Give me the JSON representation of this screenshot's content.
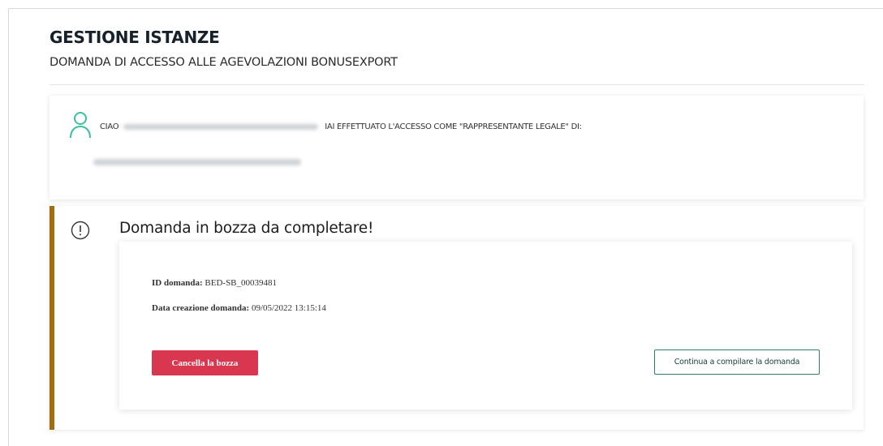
{
  "header": {
    "title": "GESTIONE ISTANZE",
    "subtitle": "DOMANDA DI ACCESSO ALLE AGEVOLAZIONI BONUSEXPORT"
  },
  "user_card": {
    "greeting_prefix": "CIAO",
    "greeting_suffix": "IAI EFFETTUATO L'ACCESSO COME \"RAPPRESENTANTE LEGALE\" DI:",
    "icon": "user-icon"
  },
  "notice": {
    "icon": "warning-circle-icon",
    "title": "Domanda in bozza da completare!",
    "id_label": "ID domanda:",
    "id_value": "BED-SB_00039481",
    "date_label": "Data creazione domanda:",
    "date_value": "09/05/2022 13:15:14",
    "delete_button": "Cancella la bozza",
    "continue_button": "Continua a compilare la domanda"
  },
  "colors": {
    "accent_green": "#2e7d6f",
    "user_icon": "#3cbf9e",
    "danger": "#d9364f",
    "warning_border": "#a66b0b"
  }
}
